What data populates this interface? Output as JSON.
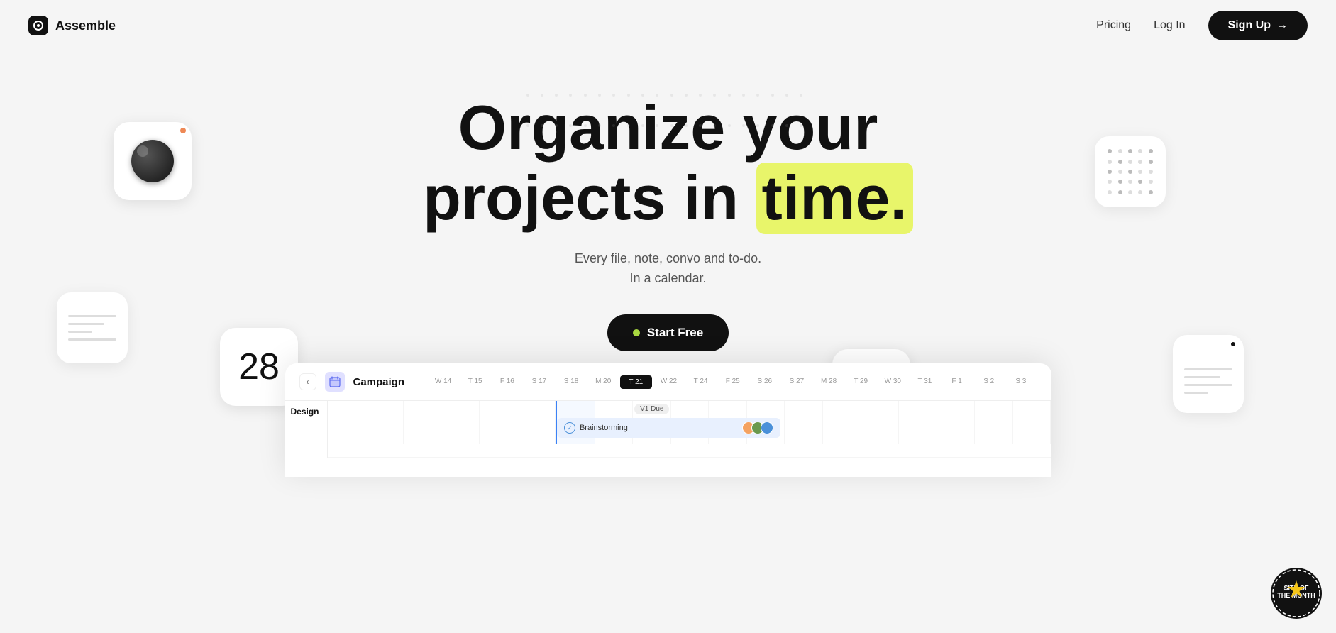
{
  "nav": {
    "logo_text": "Assemble",
    "pricing_label": "Pricing",
    "login_label": "Log In",
    "signup_label": "Sign Up",
    "signup_arrow": "→"
  },
  "hero": {
    "title_line1": "Organize your",
    "title_line2_before": "projects in ",
    "title_highlight": "time.",
    "subtitle_line1": "Every file, note, convo and to-do.",
    "subtitle_line2": "In a calendar.",
    "cta_label": "Start Free"
  },
  "widgets": {
    "calendar_number": "28",
    "dots_count": 25
  },
  "calendar": {
    "title": "Campaign",
    "col_headers": [
      {
        "label": "W 14",
        "today": false
      },
      {
        "label": "T 15",
        "today": false
      },
      {
        "label": "F 16",
        "today": false
      },
      {
        "label": "S 17",
        "today": false
      },
      {
        "label": "S 18",
        "today": false
      },
      {
        "label": "M 20",
        "today": false
      },
      {
        "label": "T 21",
        "today": true
      },
      {
        "label": "W 22",
        "today": false
      },
      {
        "label": "T 24",
        "today": false
      },
      {
        "label": "F 25",
        "today": false
      },
      {
        "label": "S 26",
        "today": false
      },
      {
        "label": "S 27",
        "today": false
      },
      {
        "label": "M 28",
        "today": false
      },
      {
        "label": "T 29",
        "today": false
      },
      {
        "label": "W 30",
        "today": false
      },
      {
        "label": "T 31",
        "today": false
      },
      {
        "label": "F 1",
        "today": false
      },
      {
        "label": "S 2",
        "today": false
      },
      {
        "label": "S 3",
        "today": false
      }
    ],
    "row_label": "Design",
    "event_label": "Brainstorming",
    "milestone_label": "V1 Due"
  }
}
